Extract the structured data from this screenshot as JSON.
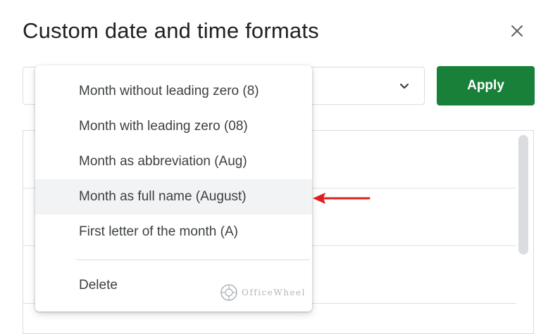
{
  "dialog": {
    "title": "Custom date and time formats",
    "apply_label": "Apply"
  },
  "menu": {
    "items": [
      {
        "label": "Month without leading zero (8)"
      },
      {
        "label": "Month with leading zero (08)"
      },
      {
        "label": "Month as abbreviation (Aug)"
      },
      {
        "label": "Month as full name (August)",
        "highlighted": true
      },
      {
        "label": "First letter of the month (A)"
      }
    ],
    "delete_label": "Delete"
  },
  "watermark": {
    "text": "OfficeWheel"
  },
  "colors": {
    "apply_bg": "#188038",
    "arrow": "#e02020",
    "highlight_bg": "#f1f3f4"
  },
  "icons": {
    "close": "close-icon",
    "dropdown": "chevron-down-icon",
    "annotation": "red-arrow-left"
  }
}
